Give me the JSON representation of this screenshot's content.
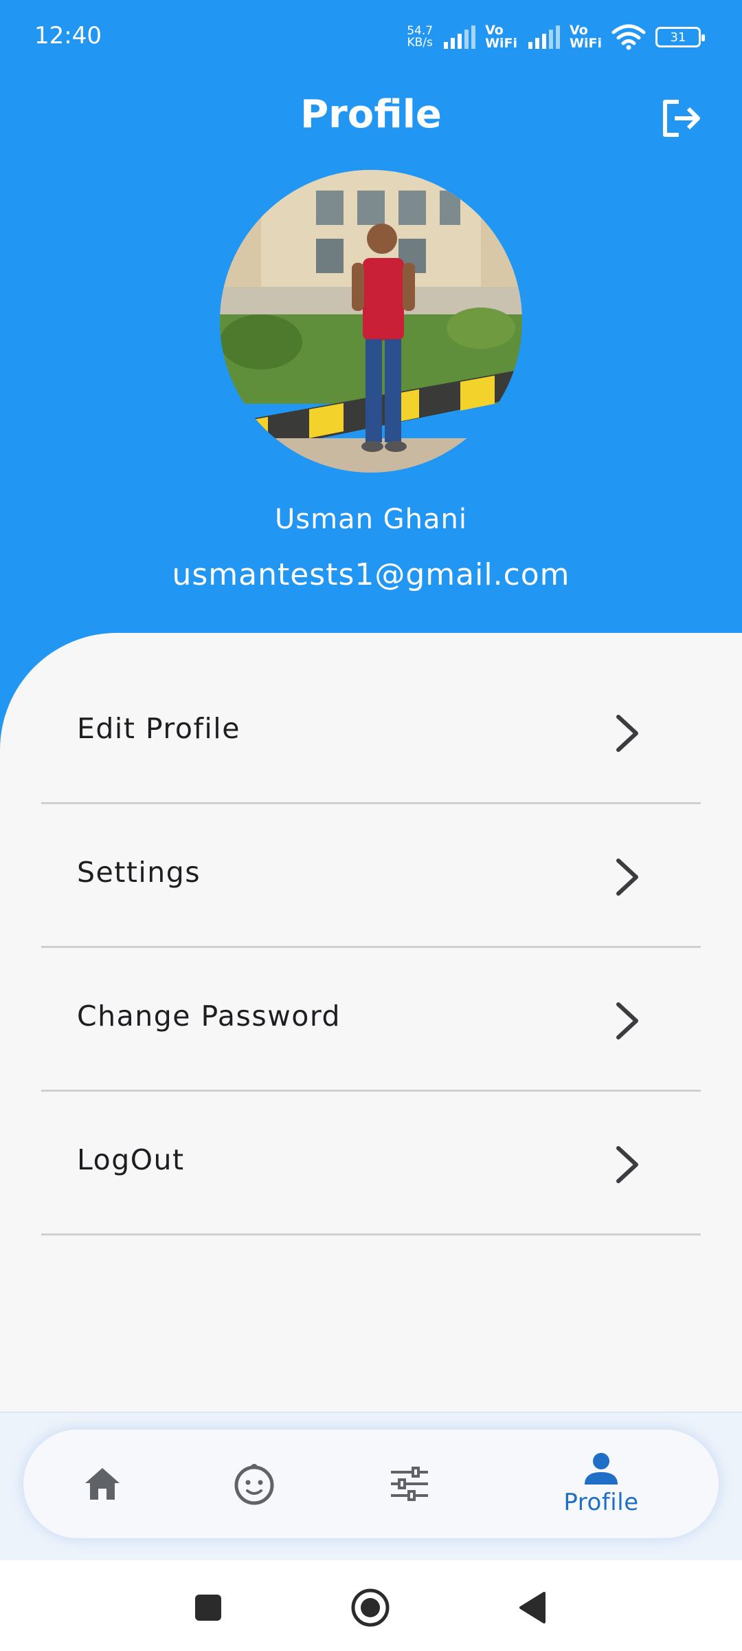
{
  "status_bar": {
    "time": "12:40",
    "net_speed_value": "54.7",
    "net_speed_unit": "KB/s",
    "vowifi_1_top": "Vo",
    "vowifi_1_bottom": "WiFi",
    "vowifi_2_top": "Vo",
    "vowifi_2_bottom": "WiFi",
    "battery": "31"
  },
  "header": {
    "title": "Profile",
    "logout_icon": "logout-icon"
  },
  "profile": {
    "name": "Usman Ghani",
    "email": "usmantests1@gmail.com"
  },
  "menu": {
    "items": [
      {
        "label": "Edit Profile",
        "icon": "chevron-right-icon"
      },
      {
        "label": "Settings",
        "icon": "chevron-right-icon"
      },
      {
        "label": "Change Password",
        "icon": "chevron-right-icon"
      },
      {
        "label": "LogOut",
        "icon": "chevron-right-icon"
      }
    ]
  },
  "bottom_nav": {
    "items": [
      {
        "icon": "home-icon",
        "label": ""
      },
      {
        "icon": "baby-face-icon",
        "label": ""
      },
      {
        "icon": "sliders-icon",
        "label": ""
      },
      {
        "icon": "person-icon",
        "label": "Profile",
        "active": true
      }
    ]
  },
  "colors": {
    "primary": "#2196f3",
    "active_nav": "#1f6fc6",
    "inactive_nav": "#5f6368",
    "background": "#f7f7f8"
  }
}
